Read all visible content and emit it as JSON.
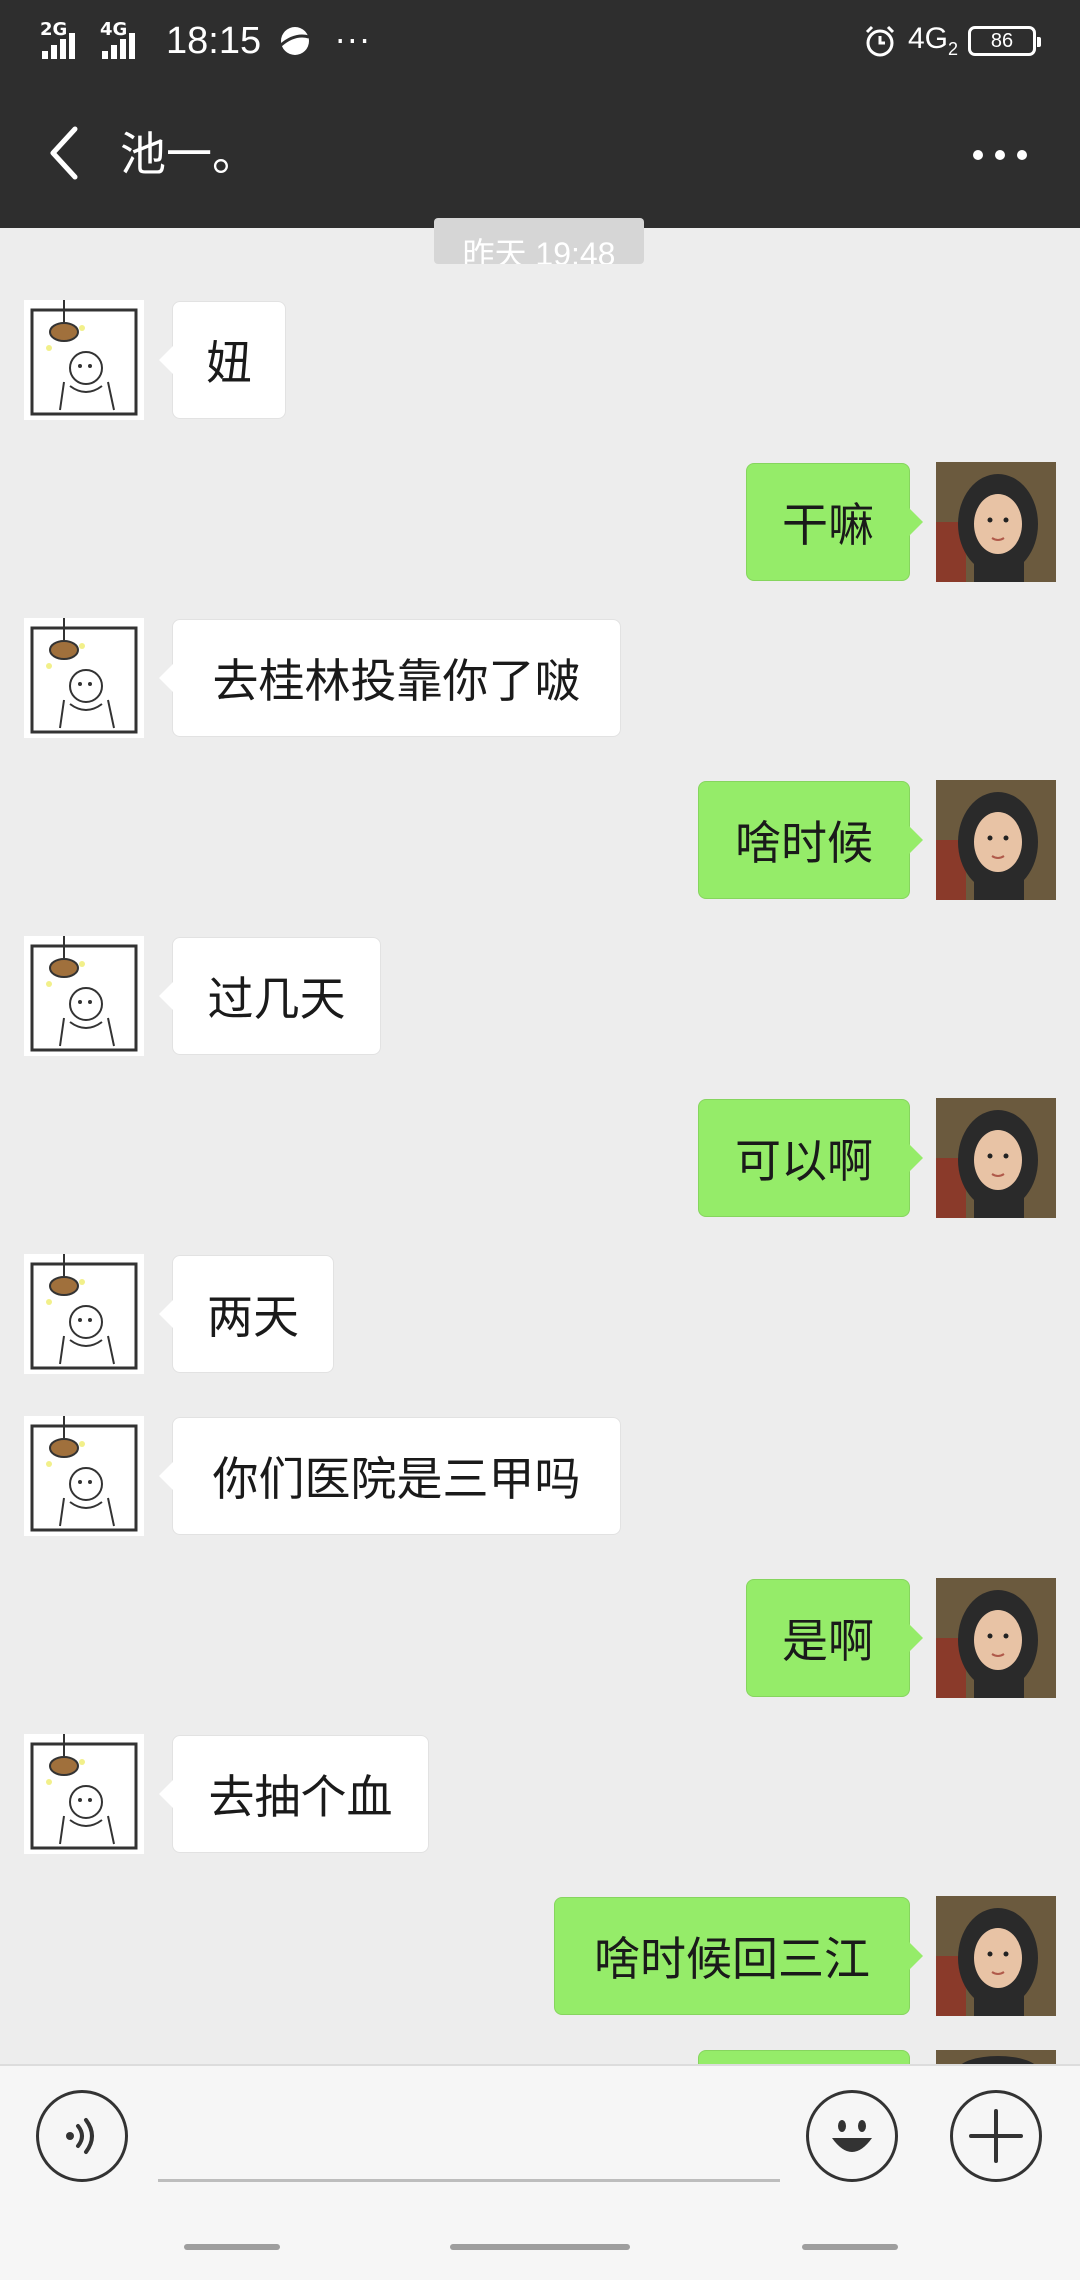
{
  "status_bar": {
    "signal_1_label": "2G",
    "signal_2_label": "4G",
    "time": "18:15",
    "dots": "···",
    "network": "4G",
    "network_sub": "2",
    "battery": "86"
  },
  "header": {
    "title": "池一。"
  },
  "timestamp": "昨天 19:48",
  "messages": [
    {
      "side": "recv",
      "text": "妞"
    },
    {
      "side": "sent",
      "text": "干嘛"
    },
    {
      "side": "recv",
      "text": "去桂林投靠你了啵"
    },
    {
      "side": "sent",
      "text": "啥时候"
    },
    {
      "side": "recv",
      "text": "过几天"
    },
    {
      "side": "sent",
      "text": "可以啊"
    },
    {
      "side": "recv",
      "text": "两天"
    },
    {
      "side": "recv",
      "text": "你们医院是三甲吗"
    },
    {
      "side": "sent",
      "text": "是啊"
    },
    {
      "side": "recv",
      "text": "去抽个血"
    },
    {
      "side": "sent",
      "text": "啥时候回三江"
    }
  ],
  "input": {
    "value": "",
    "placeholder": ""
  },
  "colors": {
    "header_bg": "#2e2e2e",
    "chat_bg": "#ededed",
    "sent_bubble": "#95ec69",
    "recv_bubble": "#ffffff"
  },
  "icons": [
    "back-arrow-icon",
    "more-icon",
    "voice-icon",
    "emoji-icon",
    "plus-icon",
    "alarm-icon"
  ]
}
